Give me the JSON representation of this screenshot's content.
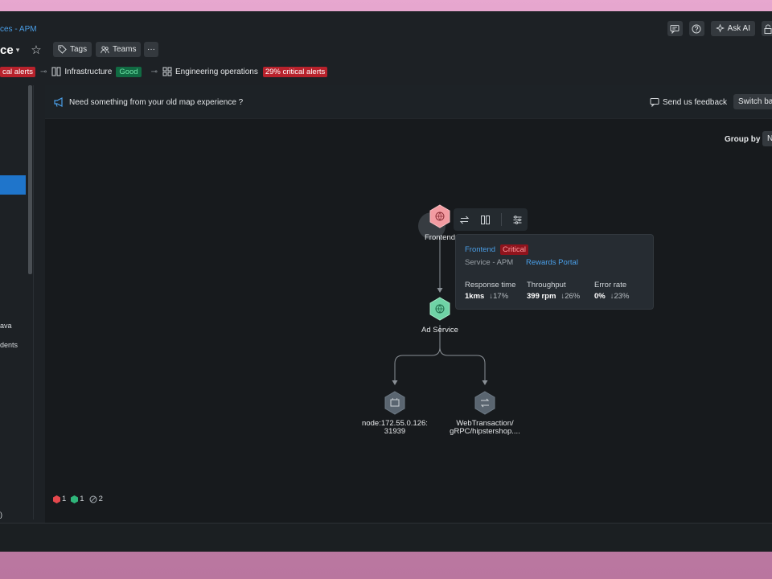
{
  "breadcrumb": "ces - APM",
  "title": "ce",
  "chips": {
    "tags": "Tags",
    "teams": "Teams",
    "more": "···"
  },
  "top_actions": {
    "ask_ai": "Ask AI"
  },
  "status": {
    "alert_badge": "cal alerts",
    "infrastructure_label": "Infrastructure",
    "infrastructure_status": "Good",
    "engineering_label": "Engineering operations",
    "engineering_badge": "29% critical alerts"
  },
  "sidebar": {
    "items": [
      "ava",
      "dents",
      ")"
    ]
  },
  "banner": {
    "text": "Need something from your old map experience ?",
    "feedback": "Send us feedback",
    "switch": "Switch ba"
  },
  "group_by": {
    "label": "Group by",
    "value": "N"
  },
  "nodes": {
    "frontend": "Frontend",
    "ad_service": "Ad Service",
    "host_line1": "node:172.55.0.126:",
    "host_line2": "31939",
    "txn_line1": "WebTransaction/",
    "txn_line2": "gRPC/hipstershop...."
  },
  "tooltip": {
    "name": "Frontend",
    "status": "Critical",
    "type": "Service - APM",
    "app": "Rewards Portal",
    "metrics": [
      {
        "label": "Response time",
        "value": "1kms",
        "change": "↓17%"
      },
      {
        "label": "Throughput",
        "value": "399 rpm",
        "change": "↓26%"
      },
      {
        "label": "Error rate",
        "value": "0%",
        "change": "↓23%"
      }
    ]
  },
  "legend": {
    "critical_count": "1",
    "healthy_count": "1",
    "unknown_count": "2"
  },
  "colors": {
    "critical": "#f29ba1",
    "healthy": "#6fd3a6",
    "neutral": "#5a6570",
    "accent": "#1f75cb"
  }
}
